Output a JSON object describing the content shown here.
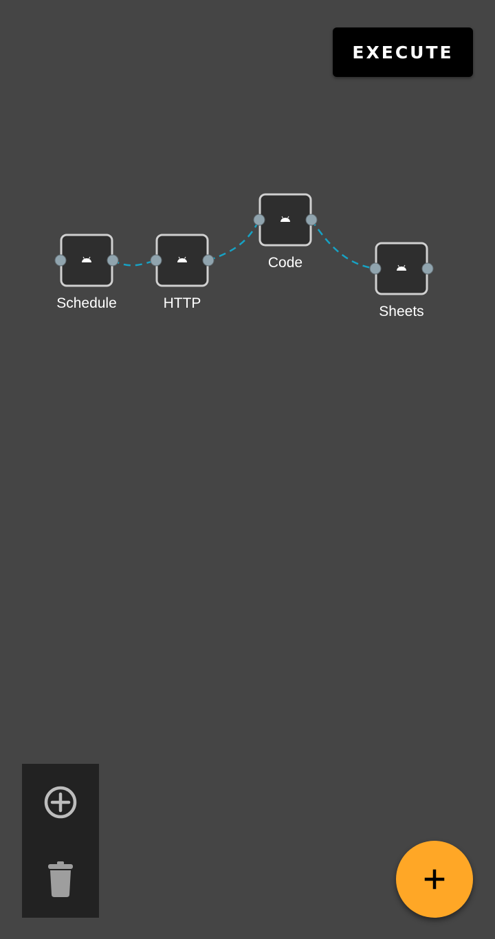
{
  "header": {
    "execute_label": "EXECUTE"
  },
  "workflow": {
    "nodes": [
      {
        "id": "schedule",
        "label": "Schedule",
        "icon": "android-icon"
      },
      {
        "id": "http",
        "label": "HTTP",
        "icon": "android-icon"
      },
      {
        "id": "code",
        "label": "Code",
        "icon": "android-icon"
      },
      {
        "id": "sheets",
        "label": "Sheets",
        "icon": "android-icon"
      }
    ],
    "connections": [
      {
        "from": "schedule",
        "to": "http"
      },
      {
        "from": "http",
        "to": "code"
      },
      {
        "from": "code",
        "to": "sheets"
      }
    ]
  },
  "toolbar": {
    "items": [
      {
        "icon": "add-circle-icon"
      },
      {
        "icon": "trash-icon"
      }
    ]
  },
  "fab": {
    "icon": "plus-icon"
  },
  "colors": {
    "background": "#454545",
    "node_fill": "#2E2E2E",
    "node_border": "#D0D0D0",
    "port": "#90A4AE",
    "connector": "#17A2C4",
    "fab": "#FFA726",
    "toolbar": "#222222"
  }
}
